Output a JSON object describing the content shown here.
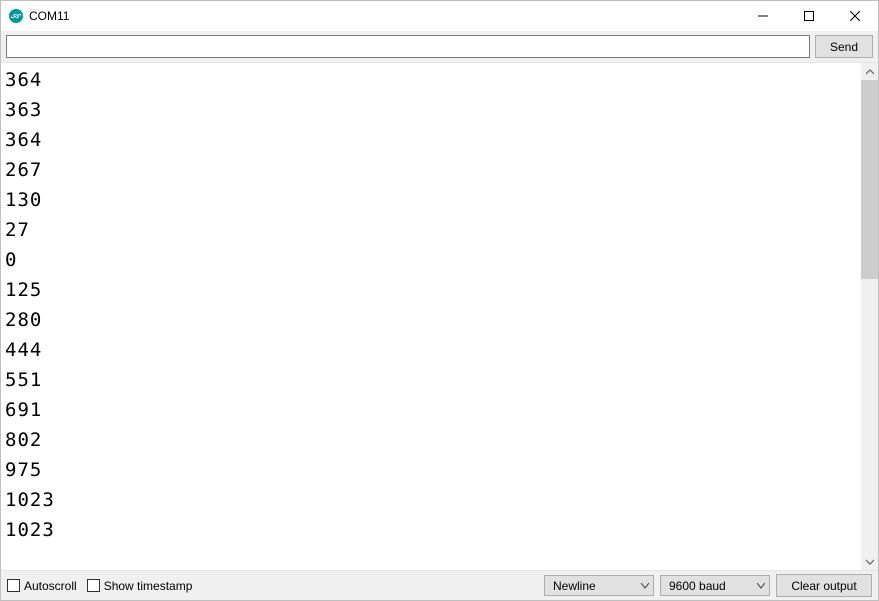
{
  "window": {
    "title": "COM11"
  },
  "toolbar": {
    "send_label": "Send",
    "input_value": ""
  },
  "console_lines": [
    "364",
    "363",
    "364",
    "267",
    "130",
    "27",
    "0",
    "125",
    "280",
    "444",
    "551",
    "691",
    "802",
    "975",
    "1023",
    "1023"
  ],
  "bottom": {
    "autoscroll_label": "Autoscroll",
    "autoscroll_checked": false,
    "show_ts_label": "Show timestamp",
    "show_ts_checked": false,
    "line_ending_value": "Newline",
    "baud_value": "9600 baud",
    "clear_label": "Clear output"
  },
  "scrollbar": {
    "thumb_top_percent": 0,
    "thumb_height_percent": 42
  }
}
